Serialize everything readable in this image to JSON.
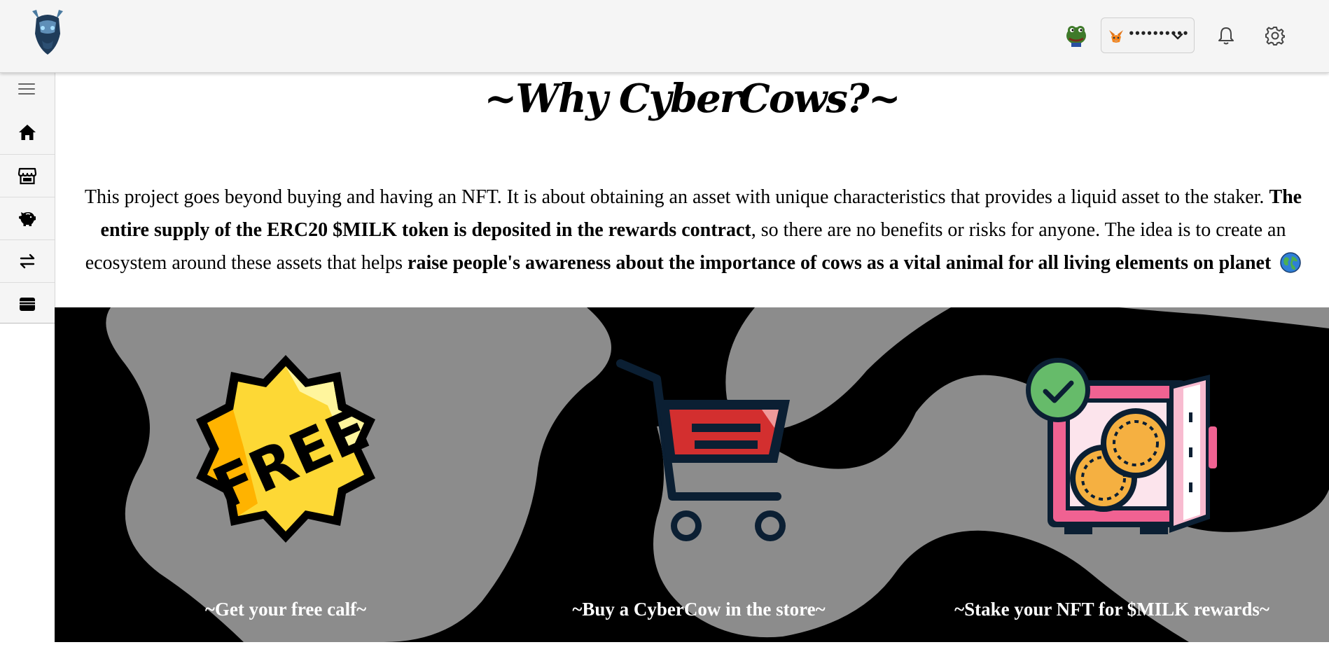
{
  "topbar": {
    "wallet": {
      "address": "••••••••••"
    }
  },
  "sidebar": {
    "items": [
      {
        "name": "home"
      },
      {
        "name": "store"
      },
      {
        "name": "piggy-bank"
      },
      {
        "name": "swap"
      },
      {
        "name": "wallet"
      }
    ]
  },
  "main": {
    "title": "~Why CyberCows?~",
    "desc_part1": "This project goes beyond buying and having an NFT. It is about obtaining an asset with unique characteristics that provides a liquid asset to the staker. ",
    "desc_bold1": "The entire supply of the ERC20 $MILK token is deposited in the rewards contract",
    "desc_part2": ", so there are no benefits or risks for anyone. The idea is to create an ecosystem around these assets that helps ",
    "desc_bold2": "raise people's awareness about the importance of cows as a vital animal for all living elements on planet",
    "features": [
      {
        "label": "~Get your free calf~",
        "icon_text": "FREE"
      },
      {
        "label": "~Buy a CyberCow in the store~"
      },
      {
        "label": "~Stake your NFT for $MILK rewards~"
      }
    ]
  },
  "colors": {
    "topbar_bg": "#f5f5f5",
    "banner_dark": "#000000",
    "banner_light": "#8c8c8c"
  }
}
